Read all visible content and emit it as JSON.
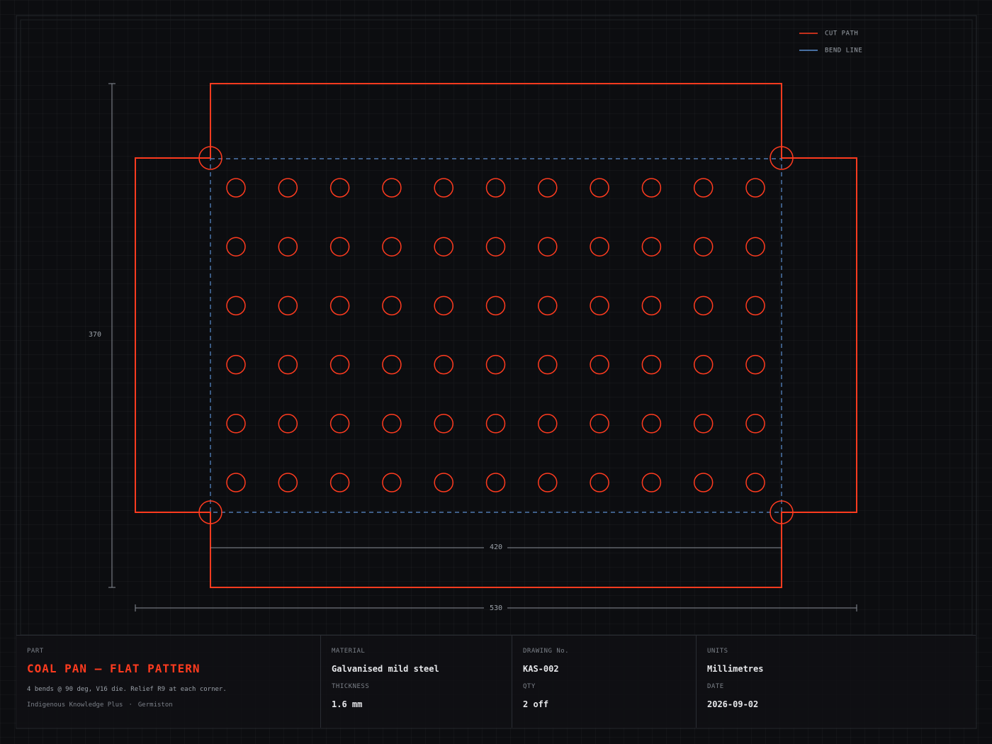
{
  "legend": {
    "cut_path": "CUT PATH",
    "bend_line": "BEND LINE"
  },
  "colors": {
    "cut": "#ff3b1f",
    "bend": "#5b8fd0",
    "dim": "#9aa0a8",
    "background": "#0c0d10"
  },
  "dimensions": {
    "overall_width": "530",
    "base_width": "420",
    "overall_height": "370"
  },
  "hole_pattern": {
    "columns": 11,
    "rows": 6
  },
  "relief_count": 4,
  "title_block": {
    "part_label": "PART",
    "part_name": "COAL PAN — FLAT PATTERN",
    "notes": "4 bends @ 90 deg, V16 die. Relief R9 at each corner.",
    "org": "Indigenous Knowledge Plus",
    "separator": "·",
    "location": "Germiston",
    "material_label": "MATERIAL",
    "material": "Galvanised mild steel",
    "thickness_label": "THICKNESS",
    "thickness": "1.6 mm",
    "drawing_no_label": "DRAWING No.",
    "drawing_no": "KAS-002",
    "qty_label": "QTY",
    "qty": "2 off",
    "units_label": "UNITS",
    "units": "Millimetres",
    "date_label": "DATE",
    "date": "2026-09-02"
  }
}
